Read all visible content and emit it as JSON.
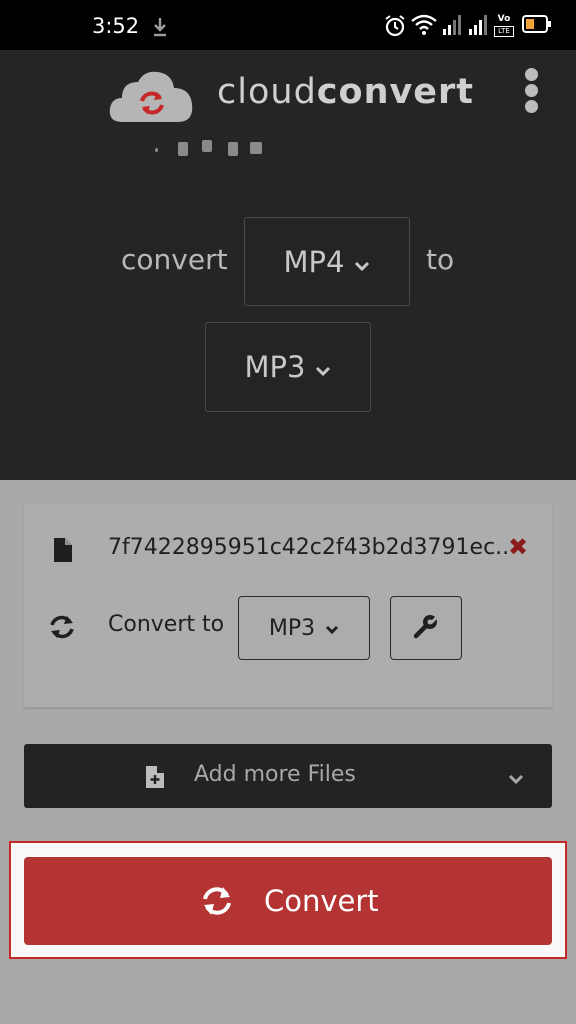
{
  "status_bar": {
    "time": "3:52",
    "icons": [
      "download-icon",
      "alarm-icon",
      "wifi-icon",
      "signal-icon",
      "signal-icon",
      "volte-icon",
      "battery-icon"
    ],
    "volte_label": "Vo",
    "lte_label": "LTE"
  },
  "header": {
    "brand_light": "cloud",
    "brand_bold": "convert",
    "menu_icon": "kebab-menu-icon"
  },
  "hero": {
    "convert_label": "convert",
    "from_format": "MP4",
    "to_label": "to",
    "to_format": "MP3"
  },
  "file": {
    "name": "7f7422895951c42c2f43b2d3791ec...",
    "remove_label": "✖",
    "convert_to_label": "Convert to",
    "target_format": "MP3",
    "settings_icon": "wrench-icon"
  },
  "add_more": {
    "label": "Add more Files"
  },
  "convert_button": {
    "label": "Convert"
  },
  "colors": {
    "dark_bg": "#252525",
    "body_bg": "#a9a9a9",
    "accent_red": "#b43333",
    "highlight_border": "#c62828"
  }
}
